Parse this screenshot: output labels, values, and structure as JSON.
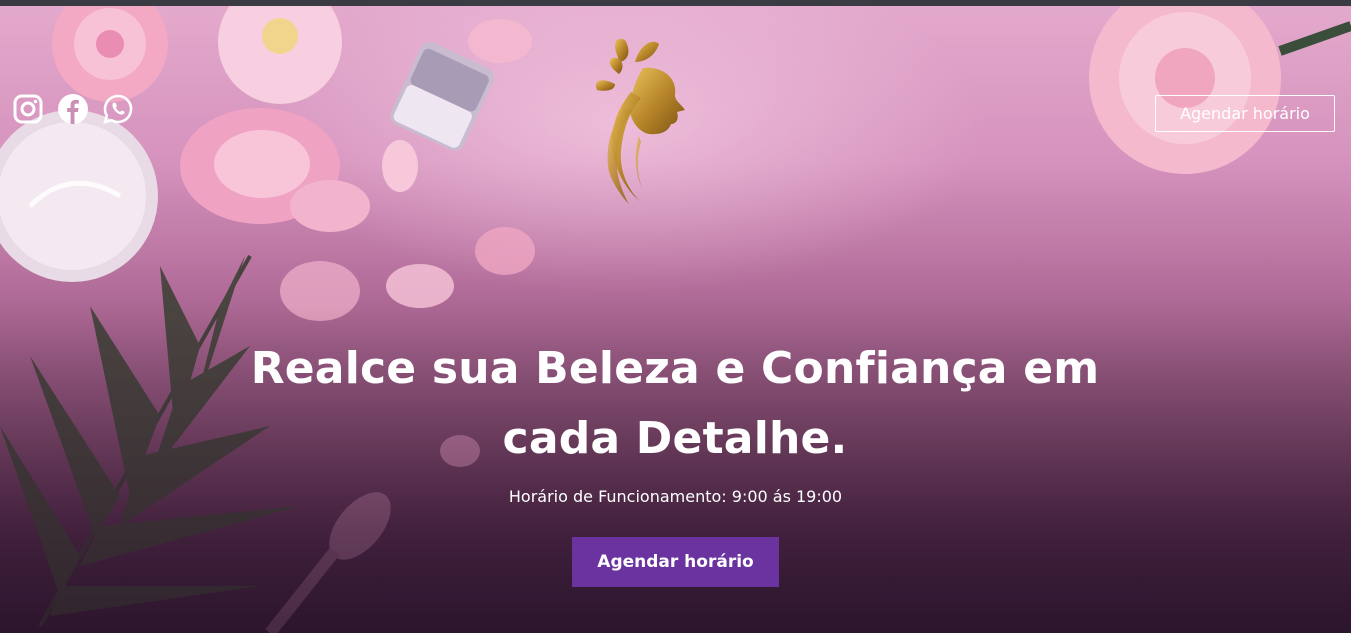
{
  "header": {
    "social": [
      {
        "name": "instagram-icon"
      },
      {
        "name": "facebook-icon"
      },
      {
        "name": "whatsapp-icon"
      }
    ],
    "logo": {
      "name": "woman-silhouette-logo"
    },
    "cta_label": "Agendar horário"
  },
  "hero": {
    "headline": "Realce sua Beleza e Confiança em cada Detalhe.",
    "hours": "Horário de Funcionamento: 9:00 ás 19:00",
    "cta_label": "Agendar horário"
  },
  "colors": {
    "primary_button": "#6a33a0",
    "logo_gold": "#b8862a",
    "text": "#ffffff"
  }
}
